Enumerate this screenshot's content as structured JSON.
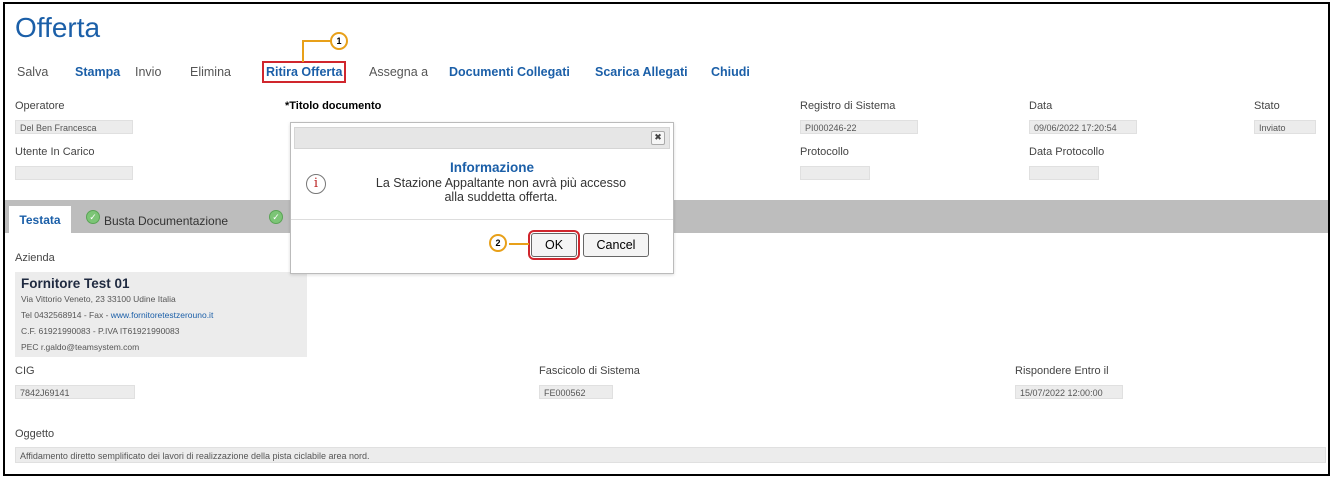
{
  "page_title": "Offerta",
  "toolbar": {
    "salva": "Salva",
    "stampa": "Stampa",
    "invio": "Invio",
    "elimina": "Elimina",
    "ritira": "Ritira Offerta",
    "assegna": "Assegna a",
    "documenti": "Documenti Collegati",
    "scarica": "Scarica Allegati",
    "chiudi": "Chiudi"
  },
  "fields": {
    "operatore_label": "Operatore",
    "operatore_value": "Del Ben Francesca",
    "titolo_label": "Titolo documento",
    "titolo_req": "*",
    "registro_label": "Registro di Sistema",
    "registro_value": "PI000246-22",
    "data_label": "Data",
    "data_value": "09/06/2022 17:20:54",
    "stato_label": "Stato",
    "stato_value": "Inviato",
    "utente_label": "Utente In Carico",
    "protocollo_label": "Protocollo",
    "data_protocollo_label": "Data Protocollo"
  },
  "tabs": {
    "testata": "Testata",
    "busta": "Busta Documentazione"
  },
  "azienda": {
    "label": "Azienda",
    "name": "Fornitore Test 01",
    "address": "Via Vittorio Veneto, 23 33100 Udine Italia",
    "tel_prefix": "Tel 0432568914 - Fax - ",
    "website": "www.fornitoretestzerouno.it",
    "cf": "C.F. 61921990083 - P.IVA IT61921990083",
    "pec": "PEC r.galdo@teamsystem.com"
  },
  "lower": {
    "cig_label": "CIG",
    "cig_value": "7842J69141",
    "fascicolo_label": "Fascicolo di Sistema",
    "fascicolo_value": "FE000562",
    "rispondere_label": "Rispondere Entro il",
    "rispondere_value": "15/07/2022 12:00:00",
    "oggetto_label": "Oggetto",
    "oggetto_value": "Affidamento diretto semplificato dei lavori di realizzazione della pista ciclabile area nord."
  },
  "dialog": {
    "title": "Informazione",
    "line1": "La Stazione Appaltante non avrà più accesso",
    "line2": "alla suddetta offerta.",
    "ok": "OK",
    "cancel": "Cancel",
    "close_glyph": "✖"
  },
  "markers": {
    "m1": "1",
    "m2": "2"
  },
  "colors": {
    "accent": "#1b5fa8",
    "highlight": "#d0262d",
    "marker": "#e8a019",
    "tabbar": "#bdbdbd"
  },
  "icons": {
    "info": "info-icon",
    "check": "check-circle-icon",
    "close": "close-icon"
  }
}
